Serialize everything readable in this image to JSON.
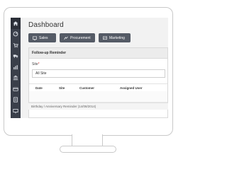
{
  "sidebar": {
    "icons": [
      {
        "name": "home-icon",
        "glyph": "⌂"
      },
      {
        "name": "dashboard-gauge-icon",
        "glyph": "◔"
      },
      {
        "name": "cart-icon",
        "glyph": "🛒"
      },
      {
        "name": "truck-icon",
        "glyph": "🚚"
      },
      {
        "name": "report-icon",
        "glyph": "▤"
      },
      {
        "name": "bank-icon",
        "glyph": "🏛"
      },
      {
        "name": "card-icon",
        "glyph": "▭"
      },
      {
        "name": "document-icon",
        "glyph": "▦"
      },
      {
        "name": "monitor-icon",
        "glyph": "▭"
      },
      {
        "name": "people-icon",
        "glyph": "⚇"
      },
      {
        "name": "settings-gear-icon",
        "glyph": "⚙"
      }
    ]
  },
  "page": {
    "title": "Dashboard"
  },
  "quick_buttons": {
    "sales": "Sales",
    "procurement": "Procurement",
    "marketing": "Marketing"
  },
  "followup": {
    "title": "Follow-up Reminder",
    "site_label": "Site",
    "required_mark": "*",
    "site_value": "All Site",
    "columns": [
      "Date",
      "Site",
      "Customer",
      "Assigned User"
    ]
  },
  "birthday": {
    "title": "Birthday / Anniversary Reminder (14/08/2014)"
  },
  "colors": {
    "sidebar_bg": "#3a3f4a",
    "button_bg": "#555b66",
    "required": "#d32f2f"
  }
}
